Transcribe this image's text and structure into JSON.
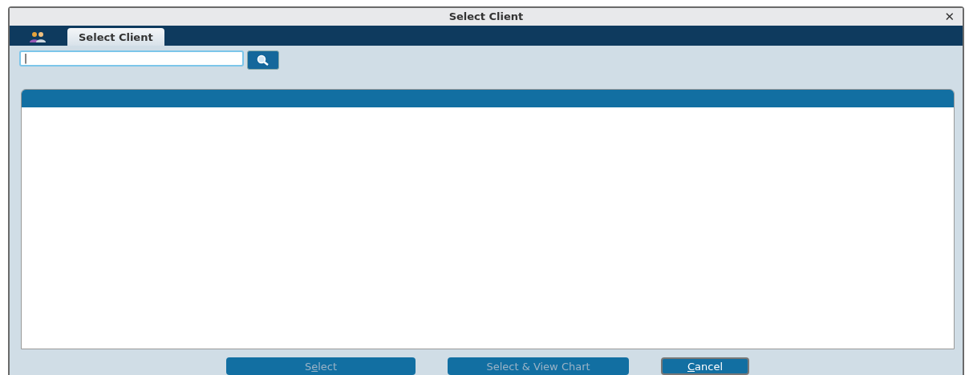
{
  "window": {
    "title": "Select Client",
    "close": "✕"
  },
  "tabs": [
    {
      "label": "Select Client",
      "selected": true
    }
  ],
  "search": {
    "value": "|"
  },
  "buttons": [
    {
      "before": "S",
      "key": "e",
      "after": "lect",
      "disabled": true
    },
    {
      "after": "Select & View Chart",
      "disabled": true
    },
    {
      "key": "C",
      "after": "ancel",
      "disabled": false
    }
  ]
}
